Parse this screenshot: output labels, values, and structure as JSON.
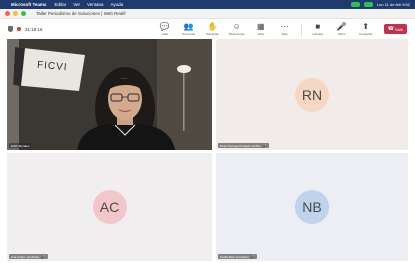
{
  "menubar": {
    "app_name": "Microsoft Teams",
    "menus": [
      "Editar",
      "Ver",
      "Ventana",
      "Ayuda"
    ],
    "clock": "Lun 11 de feb 9:52"
  },
  "window": {
    "title": "Taller Periodismo de Soluciones | Web Realif"
  },
  "toolbar": {
    "timer": "31:19:16",
    "tools": [
      {
        "icon": "chat-icon",
        "glyph": "💬",
        "label": "Chat"
      },
      {
        "icon": "people-icon",
        "glyph": "👥",
        "label": "Personas"
      },
      {
        "icon": "raise-hand-icon",
        "glyph": "✋",
        "label": "Participar"
      },
      {
        "icon": "reactions-icon",
        "glyph": "☺",
        "label": "Reacciones"
      },
      {
        "icon": "view-icon",
        "glyph": "▦",
        "label": "Vista"
      },
      {
        "icon": "more-icon",
        "glyph": "⋯",
        "label": "Más"
      }
    ],
    "controls": [
      {
        "icon": "camera-icon",
        "glyph": "■",
        "label": "Cámara"
      },
      {
        "icon": "mic-icon",
        "glyph": "🎤",
        "label": "Micro"
      },
      {
        "icon": "share-icon",
        "glyph": "⬆",
        "label": "Compartir"
      }
    ],
    "leave_label": "Salir"
  },
  "participants": [
    {
      "type": "video",
      "name": "Edith Morales",
      "banner_text": "FICVI"
    },
    {
      "type": "avatar",
      "initials": "RN",
      "name": "Rosa Noriega (Invitado Verific)"
    },
    {
      "type": "avatar",
      "initials": "AC",
      "name": "Ana Castro (Invitado)"
    },
    {
      "type": "avatar",
      "initials": "NB",
      "name": "Nadia Bello (Invitado)"
    }
  ],
  "colors": {
    "menubar": "#1e3a6e",
    "leave_button": "#c4314b",
    "avatar_rn": "#f6d8c2",
    "avatar_ac": "#f2c7c9",
    "avatar_nb": "#bfd3ec"
  }
}
